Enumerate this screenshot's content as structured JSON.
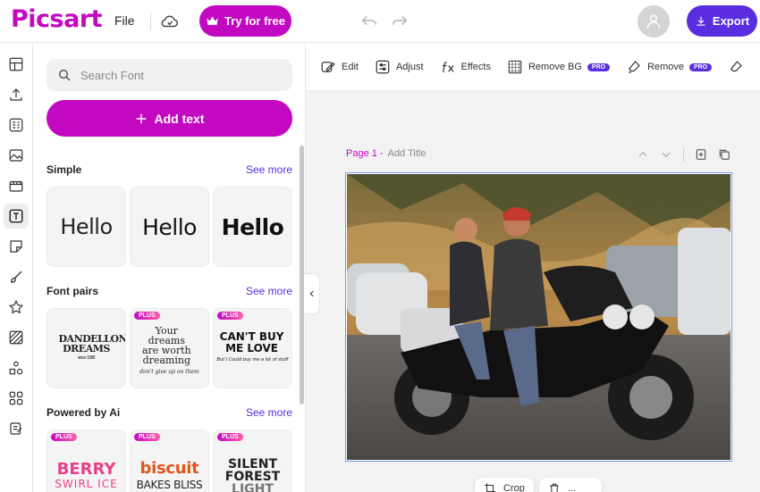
{
  "app": {
    "logo": "Picsart",
    "file_menu": "File",
    "try_button": "Try for free",
    "export_button": "Export"
  },
  "rail": {
    "items": [
      "layout-icon",
      "upload-icon",
      "templates-icon",
      "photos-icon",
      "video-icon",
      "text-icon",
      "stickers-icon",
      "brush-icon",
      "favorites-icon",
      "background-icon",
      "shapes-icon",
      "apps-icon",
      "brand-icon"
    ],
    "active": "text-icon"
  },
  "panel": {
    "search_placeholder": "Search Font",
    "add_text": "Add text",
    "sections": [
      {
        "title": "Simple",
        "see_more": "See more"
      },
      {
        "title": "Font pairs",
        "see_more": "See more"
      },
      {
        "title": "Powered by Ai",
        "see_more": "See more"
      }
    ],
    "simple_cards": [
      "Hello",
      "Hello",
      "Hello"
    ],
    "font_pairs": [
      {
        "main": "DANDELLON DREAMS",
        "sub": "since 1988",
        "plus": ""
      },
      {
        "main": "Your dreams are worth dreaming",
        "sub": "don't give up on them",
        "plus": "PLUS"
      },
      {
        "main": "CAN'T BUY ME LOVE",
        "sub": "But I Could buy me a lot of stuff",
        "plus": "PLUS"
      }
    ],
    "ai_cards": [
      {
        "main": "BERRY",
        "sub": "SWIRL ICE",
        "plus": "PLUS"
      },
      {
        "main": "biscuit",
        "sub": "BAKES BLISS",
        "plus": "PLUS"
      },
      {
        "main": "SILENT FOREST",
        "sub": "LIGHT",
        "plus": "PLUS"
      }
    ]
  },
  "toolbar": {
    "tools": [
      {
        "label": "Edit",
        "pro": ""
      },
      {
        "label": "Adjust",
        "pro": ""
      },
      {
        "label": "Effects",
        "pro": ""
      },
      {
        "label": "Remove BG",
        "pro": "PRO"
      },
      {
        "label": "Remove",
        "pro": "PRO"
      }
    ]
  },
  "canvas": {
    "page_number": "Page 1 -",
    "page_title_placeholder": "Add Title",
    "bottom_buttons": [
      "Crop",
      "..."
    ]
  },
  "colors": {
    "brand": "#c209c1",
    "accent": "#5a2de0",
    "selection": "#6f9bf0"
  }
}
